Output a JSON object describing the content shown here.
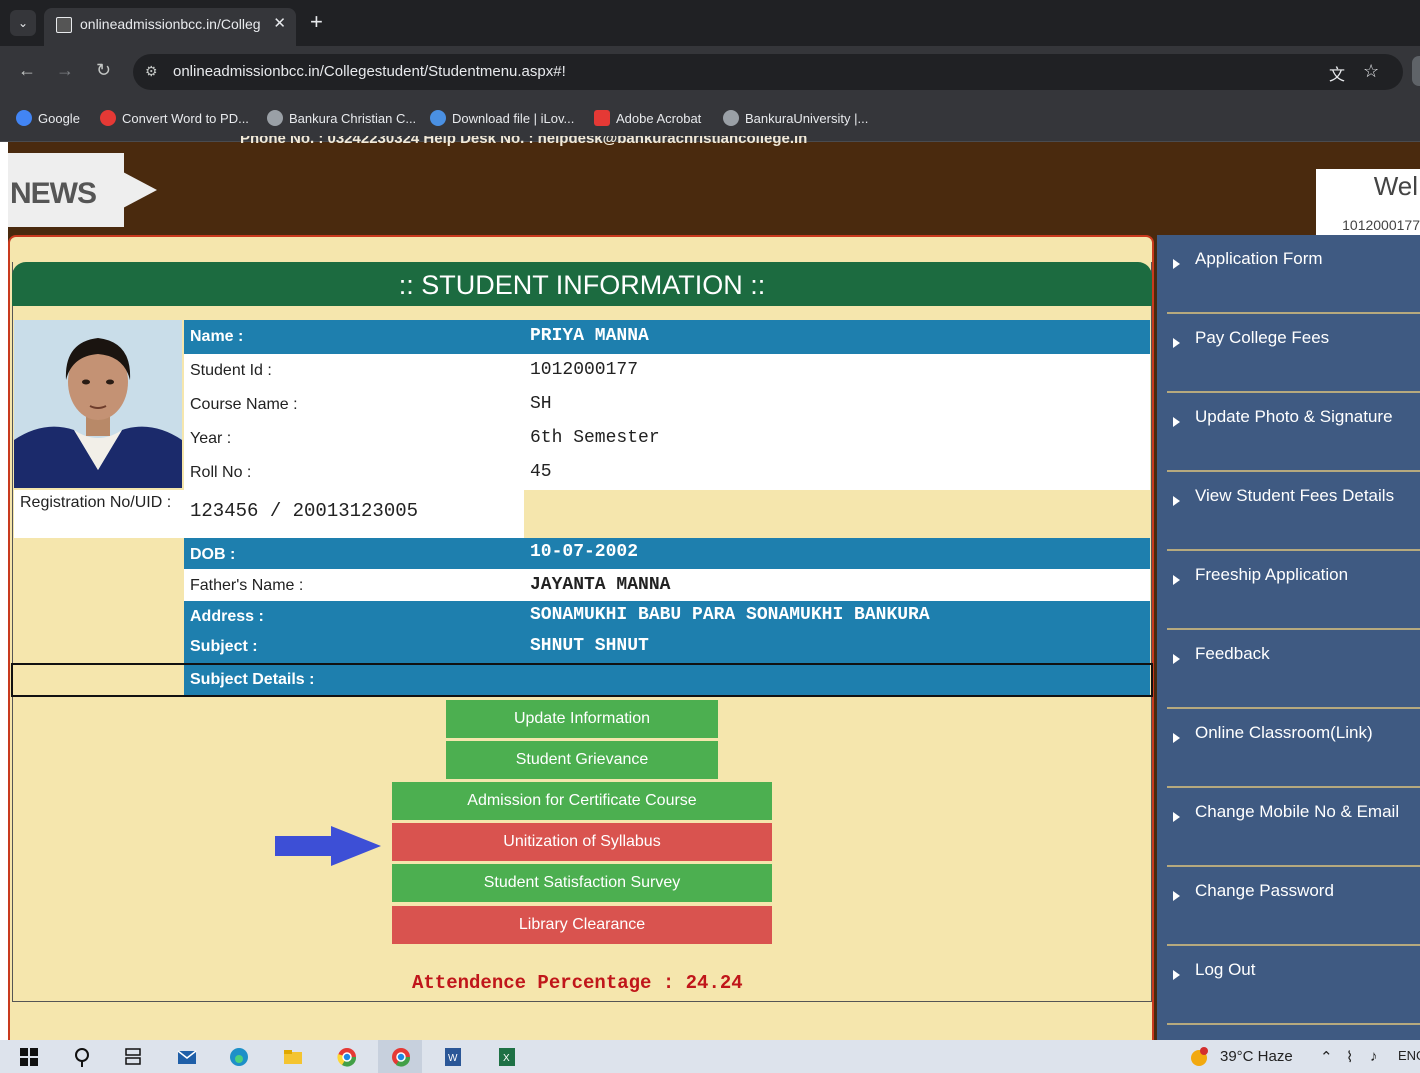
{
  "browser": {
    "tab_title": "onlineadmissionbcc.in/College",
    "url": "onlineadmissionbcc.in/Collegestudent/Studentmenu.aspx#!",
    "bookmarks": [
      {
        "label": "Google",
        "color": "#4285f4"
      },
      {
        "label": "Convert Word to PD...",
        "color": "#e53935"
      },
      {
        "label": "Bankura Christian C...",
        "color": "#9aa0a6"
      },
      {
        "label": "Download file | iLov...",
        "color": "#4a90e2"
      },
      {
        "label": "Adobe Acrobat",
        "color": "#e53935"
      },
      {
        "label": "BankuraUniversity |...",
        "color": "#9aa0a6"
      }
    ]
  },
  "header": {
    "contact_strip": "Phone No. : 03242230324     Help Desk No. : helpdesk@bankurachristiancollege.in",
    "news_label": "NEWS",
    "welcome_text": "Wel",
    "welcome_id": "1012000177"
  },
  "student": {
    "section_title": ":: STUDENT INFORMATION ::",
    "name_label": "Name :",
    "name": "PRIYA MANNA",
    "student_id_label": "Student Id :",
    "student_id": "1012000177",
    "course_label": "Course Name :",
    "course": "SH",
    "year_label": "Year :",
    "year": "6th Semester",
    "roll_label": "Roll No :",
    "roll": "45",
    "reg_label": "Registration No/UID :",
    "reg": "123456 / 20013123005",
    "dob_label": "DOB :",
    "dob": "10-07-2002",
    "father_label": "Father's Name :",
    "father": "JAYANTA MANNA",
    "address_label": "Address :",
    "address": "SONAMUKHI BABU PARA SONAMUKHI BANKURA",
    "subject_label": "Subject :",
    "subject": "SHNUT SHNUT",
    "subject_details_label": "Subject Details :"
  },
  "actions": {
    "update_info": "Update Information",
    "grievance": "Student Grievance",
    "certificate": "Admission for Certificate Course",
    "unitization": "Unitization of Syllabus",
    "survey": "Student Satisfaction Survey",
    "library": "Library Clearance"
  },
  "attendance": "Attendence Percentage : 24.24",
  "sidebar": {
    "items": [
      {
        "label": "Application Form"
      },
      {
        "label": "Pay College Fees"
      },
      {
        "label": "Update Photo & Signature"
      },
      {
        "label": "View Student Fees Details"
      },
      {
        "label": "Freeship Application"
      },
      {
        "label": "Feedback"
      },
      {
        "label": "Online Classroom(Link)"
      },
      {
        "label": "Change Mobile No & Email"
      },
      {
        "label": "Change Password"
      },
      {
        "label": "Log Out"
      }
    ]
  },
  "taskbar": {
    "weather": "39°C Haze",
    "lang": "ENG"
  },
  "colors": {
    "header_bg": "#4a2a0e",
    "panel_bg": "#f5e6ad",
    "section_green": "#1c6b40",
    "row_blue": "#1e7fae",
    "sidebar_bg": "#3f5a82",
    "button_green": "#4caf50",
    "button_red": "#d9534f"
  }
}
